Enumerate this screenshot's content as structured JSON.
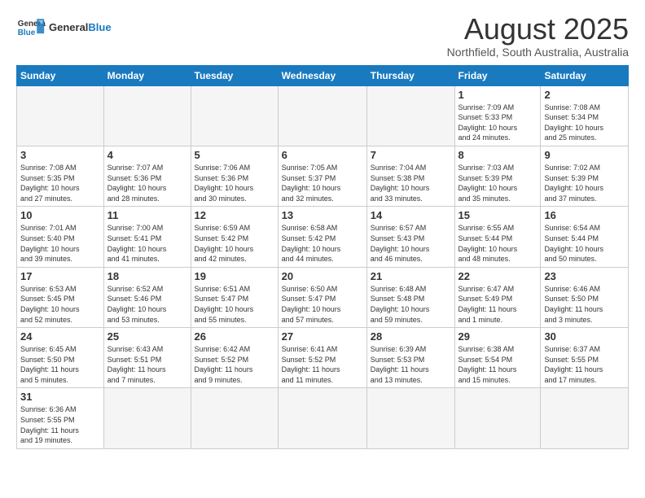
{
  "header": {
    "logo_general": "General",
    "logo_blue": "Blue",
    "month_title": "August 2025",
    "location": "Northfield, South Australia, Australia"
  },
  "weekdays": [
    "Sunday",
    "Monday",
    "Tuesday",
    "Wednesday",
    "Thursday",
    "Friday",
    "Saturday"
  ],
  "weeks": [
    [
      {
        "day": "",
        "info": ""
      },
      {
        "day": "",
        "info": ""
      },
      {
        "day": "",
        "info": ""
      },
      {
        "day": "",
        "info": ""
      },
      {
        "day": "",
        "info": ""
      },
      {
        "day": "1",
        "info": "Sunrise: 7:09 AM\nSunset: 5:33 PM\nDaylight: 10 hours\nand 24 minutes."
      },
      {
        "day": "2",
        "info": "Sunrise: 7:08 AM\nSunset: 5:34 PM\nDaylight: 10 hours\nand 25 minutes."
      }
    ],
    [
      {
        "day": "3",
        "info": "Sunrise: 7:08 AM\nSunset: 5:35 PM\nDaylight: 10 hours\nand 27 minutes."
      },
      {
        "day": "4",
        "info": "Sunrise: 7:07 AM\nSunset: 5:36 PM\nDaylight: 10 hours\nand 28 minutes."
      },
      {
        "day": "5",
        "info": "Sunrise: 7:06 AM\nSunset: 5:36 PM\nDaylight: 10 hours\nand 30 minutes."
      },
      {
        "day": "6",
        "info": "Sunrise: 7:05 AM\nSunset: 5:37 PM\nDaylight: 10 hours\nand 32 minutes."
      },
      {
        "day": "7",
        "info": "Sunrise: 7:04 AM\nSunset: 5:38 PM\nDaylight: 10 hours\nand 33 minutes."
      },
      {
        "day": "8",
        "info": "Sunrise: 7:03 AM\nSunset: 5:39 PM\nDaylight: 10 hours\nand 35 minutes."
      },
      {
        "day": "9",
        "info": "Sunrise: 7:02 AM\nSunset: 5:39 PM\nDaylight: 10 hours\nand 37 minutes."
      }
    ],
    [
      {
        "day": "10",
        "info": "Sunrise: 7:01 AM\nSunset: 5:40 PM\nDaylight: 10 hours\nand 39 minutes."
      },
      {
        "day": "11",
        "info": "Sunrise: 7:00 AM\nSunset: 5:41 PM\nDaylight: 10 hours\nand 41 minutes."
      },
      {
        "day": "12",
        "info": "Sunrise: 6:59 AM\nSunset: 5:42 PM\nDaylight: 10 hours\nand 42 minutes."
      },
      {
        "day": "13",
        "info": "Sunrise: 6:58 AM\nSunset: 5:42 PM\nDaylight: 10 hours\nand 44 minutes."
      },
      {
        "day": "14",
        "info": "Sunrise: 6:57 AM\nSunset: 5:43 PM\nDaylight: 10 hours\nand 46 minutes."
      },
      {
        "day": "15",
        "info": "Sunrise: 6:55 AM\nSunset: 5:44 PM\nDaylight: 10 hours\nand 48 minutes."
      },
      {
        "day": "16",
        "info": "Sunrise: 6:54 AM\nSunset: 5:44 PM\nDaylight: 10 hours\nand 50 minutes."
      }
    ],
    [
      {
        "day": "17",
        "info": "Sunrise: 6:53 AM\nSunset: 5:45 PM\nDaylight: 10 hours\nand 52 minutes."
      },
      {
        "day": "18",
        "info": "Sunrise: 6:52 AM\nSunset: 5:46 PM\nDaylight: 10 hours\nand 53 minutes."
      },
      {
        "day": "19",
        "info": "Sunrise: 6:51 AM\nSunset: 5:47 PM\nDaylight: 10 hours\nand 55 minutes."
      },
      {
        "day": "20",
        "info": "Sunrise: 6:50 AM\nSunset: 5:47 PM\nDaylight: 10 hours\nand 57 minutes."
      },
      {
        "day": "21",
        "info": "Sunrise: 6:48 AM\nSunset: 5:48 PM\nDaylight: 10 hours\nand 59 minutes."
      },
      {
        "day": "22",
        "info": "Sunrise: 6:47 AM\nSunset: 5:49 PM\nDaylight: 11 hours\nand 1 minute."
      },
      {
        "day": "23",
        "info": "Sunrise: 6:46 AM\nSunset: 5:50 PM\nDaylight: 11 hours\nand 3 minutes."
      }
    ],
    [
      {
        "day": "24",
        "info": "Sunrise: 6:45 AM\nSunset: 5:50 PM\nDaylight: 11 hours\nand 5 minutes."
      },
      {
        "day": "25",
        "info": "Sunrise: 6:43 AM\nSunset: 5:51 PM\nDaylight: 11 hours\nand 7 minutes."
      },
      {
        "day": "26",
        "info": "Sunrise: 6:42 AM\nSunset: 5:52 PM\nDaylight: 11 hours\nand 9 minutes."
      },
      {
        "day": "27",
        "info": "Sunrise: 6:41 AM\nSunset: 5:52 PM\nDaylight: 11 hours\nand 11 minutes."
      },
      {
        "day": "28",
        "info": "Sunrise: 6:39 AM\nSunset: 5:53 PM\nDaylight: 11 hours\nand 13 minutes."
      },
      {
        "day": "29",
        "info": "Sunrise: 6:38 AM\nSunset: 5:54 PM\nDaylight: 11 hours\nand 15 minutes."
      },
      {
        "day": "30",
        "info": "Sunrise: 6:37 AM\nSunset: 5:55 PM\nDaylight: 11 hours\nand 17 minutes."
      }
    ],
    [
      {
        "day": "31",
        "info": "Sunrise: 6:36 AM\nSunset: 5:55 PM\nDaylight: 11 hours\nand 19 minutes."
      },
      {
        "day": "",
        "info": ""
      },
      {
        "day": "",
        "info": ""
      },
      {
        "day": "",
        "info": ""
      },
      {
        "day": "",
        "info": ""
      },
      {
        "day": "",
        "info": ""
      },
      {
        "day": "",
        "info": ""
      }
    ]
  ]
}
